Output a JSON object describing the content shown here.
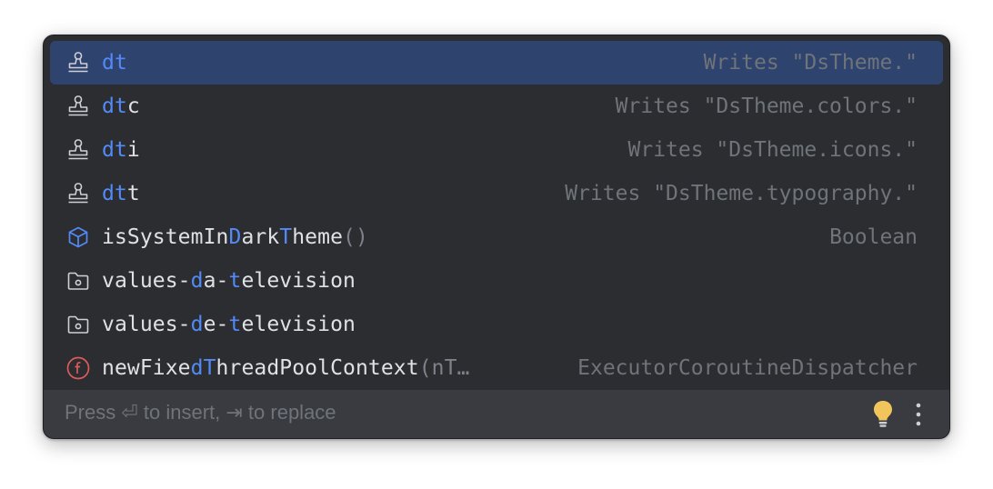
{
  "popup": {
    "items": [
      {
        "icon": "stamp-icon",
        "match": "dt",
        "rest": "",
        "tail": "Writes \"DsTheme.\"",
        "selected": true
      },
      {
        "icon": "stamp-icon",
        "match": "dt",
        "rest": "c",
        "tail": "Writes \"DsTheme.colors.\""
      },
      {
        "icon": "stamp-icon",
        "match": "dt",
        "rest": "i",
        "tail": "Writes \"DsTheme.icons.\""
      },
      {
        "icon": "stamp-icon",
        "match": "dt",
        "rest": "t",
        "tail": "Writes \"DsTheme.typography.\""
      },
      {
        "icon": "interface-cube-icon",
        "p1": "isSystemIn",
        "m1": "D",
        "p2": "ark",
        "m2": "T",
        "p3": "heme",
        "params": "()",
        "tail": "Boolean"
      },
      {
        "icon": "folder-icon",
        "p1": "values-",
        "m1": "d",
        "p2": "a-",
        "m2": "t",
        "p3": "elevision"
      },
      {
        "icon": "folder-icon",
        "p1": "values-",
        "m1": "d",
        "p2": "e-",
        "m2": "t",
        "p3": "elevision"
      },
      {
        "icon": "function-icon",
        "p1": "newFixe",
        "m1": "d",
        "p2": "",
        "m2": "T",
        "p3": "hreadPoolContext",
        "params": "(nT…",
        "tail": "ExecutorCoroutineDispatcher"
      }
    ],
    "footer": {
      "hint": "Press ⏎ to insert, ⇥ to replace",
      "bulb_color": "#f2c55c",
      "icons": [
        "lightbulb-icon",
        "more-vertical-icon"
      ]
    }
  },
  "colors": {
    "background": "#2b2d30",
    "selection": "#2e436e",
    "match": "#548af7",
    "text": "#dfe1e5",
    "secondary": "#6f737a",
    "function_icon": "#db5c5c"
  }
}
